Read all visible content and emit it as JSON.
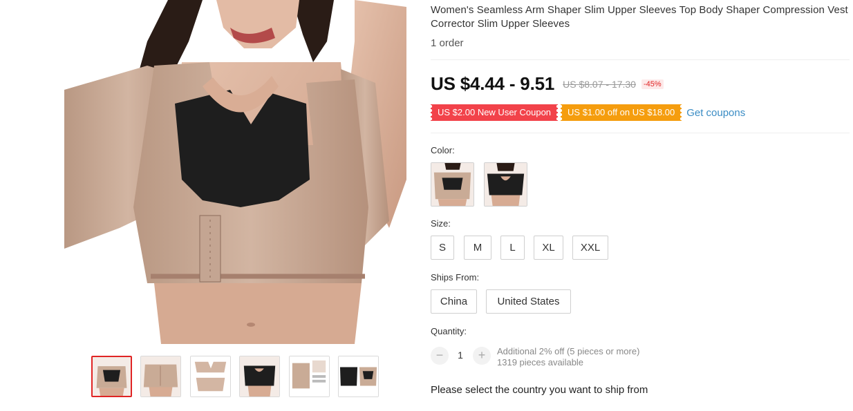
{
  "product": {
    "title": "Women's Seamless Arm Shaper Slim Upper Sleeves Top Body Shaper Compression Vest Corrector Slim Upper Sleeves",
    "orders": "1 order"
  },
  "price": {
    "current": "US $4.44 - 9.51",
    "original": "US $8.07 - 17.30",
    "discount": "-45%"
  },
  "coupons": {
    "items": [
      {
        "text": "US $2.00 New User Coupon",
        "color": "#f2424a"
      },
      {
        "text": "US $1.00 off on US $18.00",
        "color": "#f59d0e"
      }
    ],
    "link": "Get coupons"
  },
  "color": {
    "label": "Color:",
    "options": [
      {
        "name": "nude",
        "icon": "nude-shaper-photo"
      },
      {
        "name": "black",
        "icon": "black-shaper-photo"
      }
    ]
  },
  "size": {
    "label": "Size:",
    "options": [
      "S",
      "M",
      "L",
      "XL",
      "XXL"
    ]
  },
  "ships_from": {
    "label": "Ships From:",
    "options": [
      "China",
      "United States"
    ]
  },
  "quantity": {
    "label": "Quantity:",
    "decrement": "−",
    "increment": "+",
    "value": "1",
    "note": "Additional 2% off (5 pieces or more)",
    "available": "1319 pieces available"
  },
  "shipping_message": "Please select the country you want to ship from",
  "gallery": {
    "thumbnails": [
      "front-view",
      "back-view",
      "flat-lay",
      "black-front",
      "size-chart",
      "comparison"
    ],
    "active_index": 0
  },
  "colors": {
    "accent_red": "#e02424",
    "coupon_red": "#f2424a",
    "coupon_orange": "#f59d0e",
    "link_blue": "#3a8cc4",
    "fabric_nude": "#c9ab96",
    "fabric_black": "#1e1e1e"
  }
}
